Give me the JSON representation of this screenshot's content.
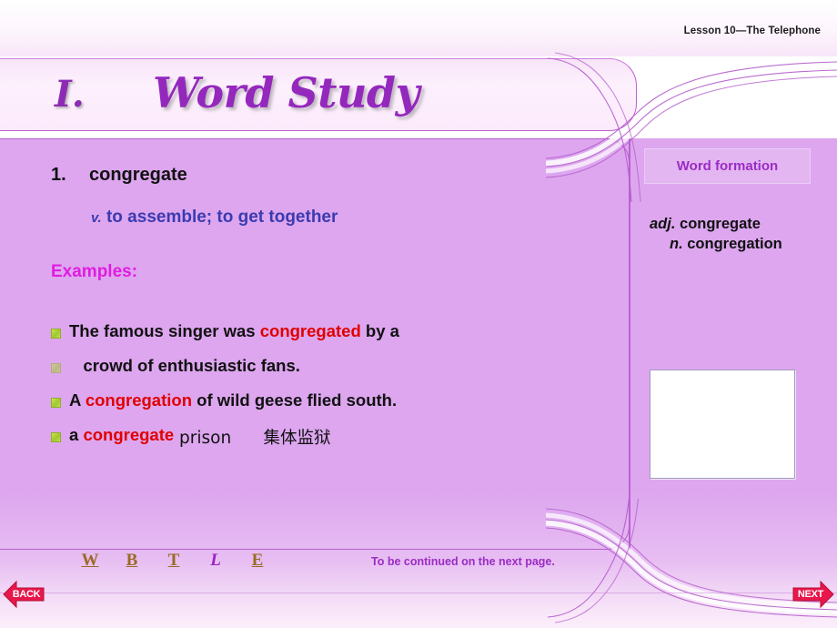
{
  "header": {
    "lesson_title": "Lesson 10—The Telephone"
  },
  "title": {
    "roman_numeral": "I.",
    "text": "Word Study"
  },
  "main": {
    "entry_number": "1.",
    "entry_word": "congregate",
    "pos_abbr": "v.",
    "definition": "to assemble; to get together",
    "examples_label": "Examples:",
    "examples": [
      {
        "before": "The famous singer was ",
        "highlight": "congregated",
        "after": " by a",
        "bullet": "square-bullet-icon"
      },
      {
        "before": "   crowd of enthusiastic fans.",
        "highlight": "",
        "after": "",
        "bullet": "square-bullet-icon-faded"
      },
      {
        "before": "A ",
        "highlight": "congregation",
        "after": " of wild geese flied south.",
        "bullet": "square-bullet-icon"
      },
      {
        "before": "a ",
        "highlight": "congregate",
        "after": " prison      集体监狱",
        "bullet": "square-bullet-icon"
      }
    ]
  },
  "sidebar": {
    "word_formation_title": "Word formation",
    "forms": [
      {
        "abbr": "adj.",
        "word": " congregate"
      },
      {
        "abbr": "n.",
        "word": " congregation"
      }
    ],
    "image_placeholder": "image-placeholder"
  },
  "footer": {
    "nav_links": [
      {
        "label": "W",
        "style": "plain"
      },
      {
        "label": "B",
        "style": "plain"
      },
      {
        "label": "T",
        "style": "plain"
      },
      {
        "label": "L",
        "style": "accent"
      },
      {
        "label": "E",
        "style": "plain"
      }
    ],
    "note": "To be continued on the next page.",
    "back_label": "BACK",
    "next_label": "NEXT"
  },
  "colors": {
    "panel_purple": "#dda6ef",
    "title_purple": "#9428bd",
    "highlight_red": "#e00000",
    "magenta": "#e11ce1",
    "definition_blue": "#3b3bb0",
    "arrow_red": "#e8174b",
    "link_brown": "#9a6b25"
  }
}
